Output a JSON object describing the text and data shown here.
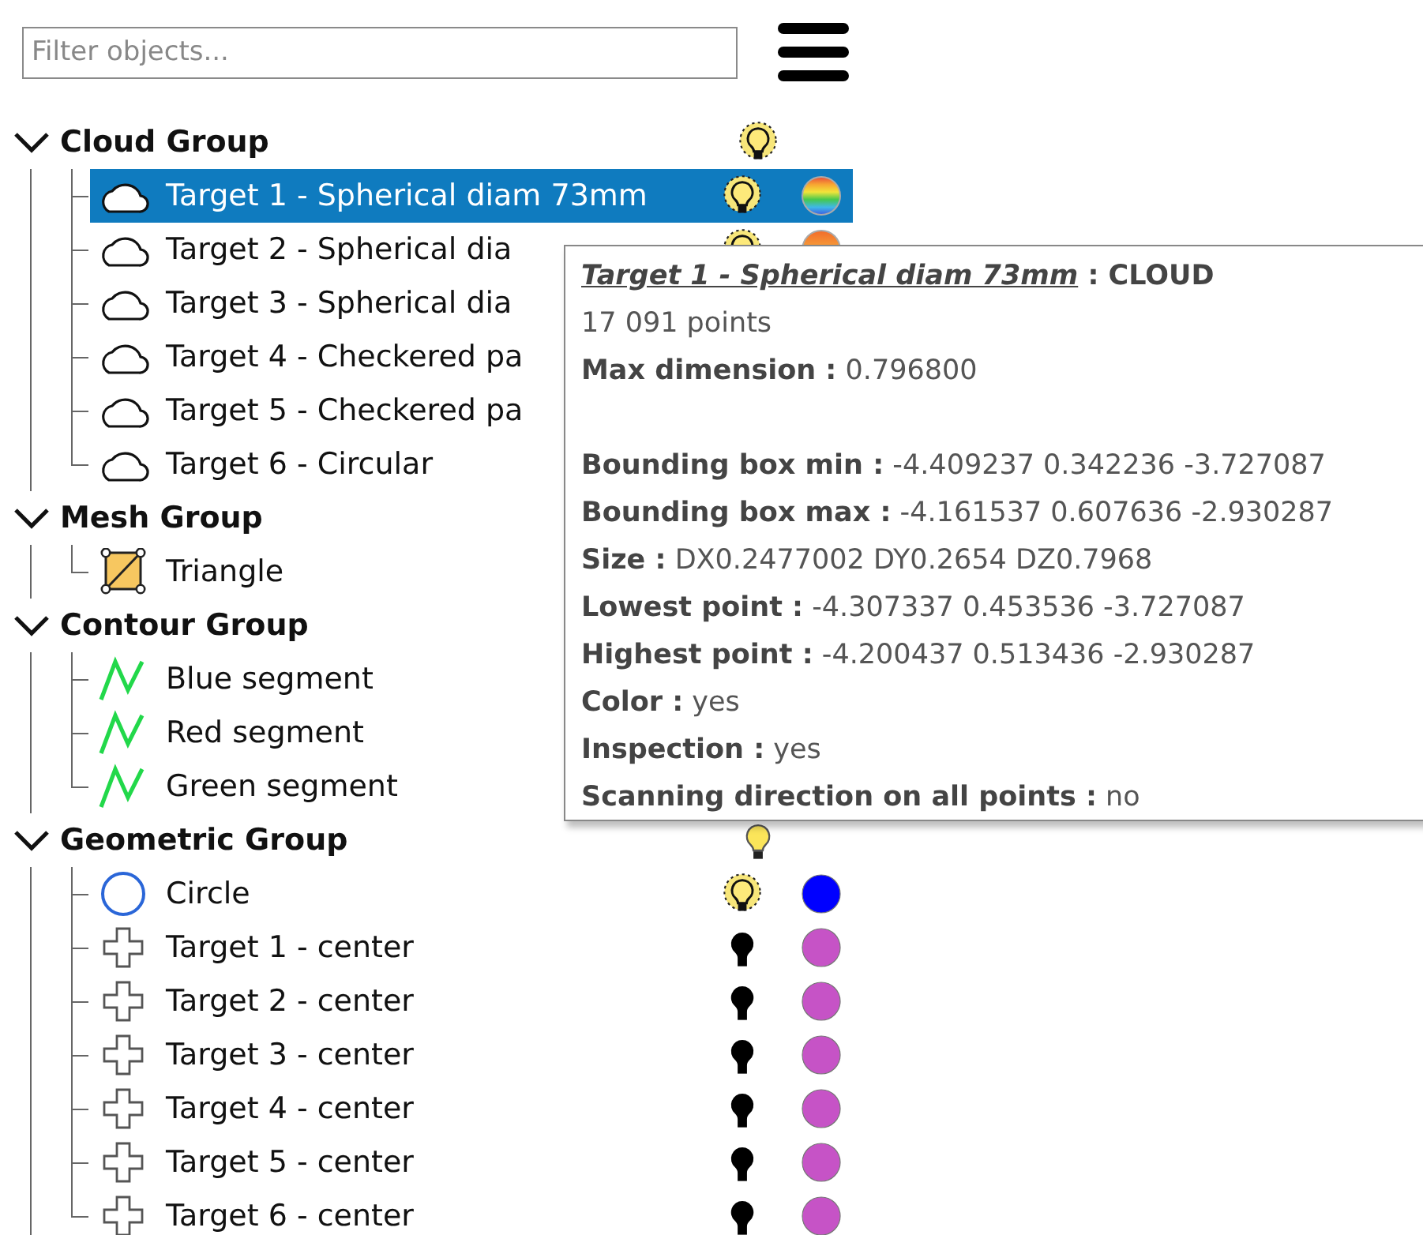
{
  "filter": {
    "placeholder": "Filter objects..."
  },
  "groups": [
    {
      "name": "Cloud Group",
      "expanded": true,
      "light": {
        "lit": true,
        "glow": true
      },
      "items": [
        {
          "kind": "cloud",
          "label": "Target 1 - Spherical diam 73mm",
          "selected": true,
          "light": {
            "lit": true,
            "glow": true
          },
          "dot": {
            "kind": "rainbow"
          }
        },
        {
          "kind": "cloud",
          "label": "Target 2 - Spherical dia",
          "selected": false,
          "light": {
            "lit": true,
            "glow": true
          },
          "dot": {
            "kind": "warm"
          }
        },
        {
          "kind": "cloud",
          "label": "Target 3 - Spherical dia",
          "selected": false
        },
        {
          "kind": "cloud",
          "label": "Target 4 - Checkered pa",
          "selected": false
        },
        {
          "kind": "cloud",
          "label": "Target 5 - Checkered pa",
          "selected": false
        },
        {
          "kind": "cloud",
          "label": "Target 6 - Circular",
          "selected": false
        }
      ]
    },
    {
      "name": "Mesh Group",
      "expanded": true,
      "items": [
        {
          "kind": "mesh",
          "label": "Triangle",
          "selected": false
        }
      ]
    },
    {
      "name": "Contour Group",
      "expanded": true,
      "items": [
        {
          "kind": "polyline",
          "label": "Blue segment",
          "selected": false
        },
        {
          "kind": "polyline",
          "label": "Red segment",
          "selected": false
        },
        {
          "kind": "polyline",
          "label": "Green segment",
          "selected": false
        }
      ]
    },
    {
      "name": "Geometric Group",
      "expanded": true,
      "light": {
        "lit": true,
        "glow": false
      },
      "items": [
        {
          "kind": "circle",
          "label": "Circle",
          "selected": false,
          "light": {
            "lit": true,
            "glow": true
          },
          "dot": {
            "kind": "solid",
            "color": "#0000ff"
          }
        },
        {
          "kind": "point",
          "label": "Target 1 - center",
          "selected": false,
          "light": {
            "lit": false,
            "glow": false
          },
          "dot": {
            "kind": "solid",
            "color": "#c653c6"
          }
        },
        {
          "kind": "point",
          "label": "Target 2 - center",
          "selected": false,
          "light": {
            "lit": false,
            "glow": false
          },
          "dot": {
            "kind": "solid",
            "color": "#c653c6"
          }
        },
        {
          "kind": "point",
          "label": "Target 3 - center",
          "selected": false,
          "light": {
            "lit": false,
            "glow": false
          },
          "dot": {
            "kind": "solid",
            "color": "#c653c6"
          }
        },
        {
          "kind": "point",
          "label": "Target 4 - center",
          "selected": false,
          "light": {
            "lit": false,
            "glow": false
          },
          "dot": {
            "kind": "solid",
            "color": "#c653c6"
          }
        },
        {
          "kind": "point",
          "label": "Target 5 - center",
          "selected": false,
          "light": {
            "lit": false,
            "glow": false
          },
          "dot": {
            "kind": "solid",
            "color": "#c653c6"
          }
        },
        {
          "kind": "point",
          "label": "Target 6 - center",
          "selected": false,
          "light": {
            "lit": false,
            "glow": false
          },
          "dot": {
            "kind": "solid",
            "color": "#c653c6"
          }
        }
      ]
    }
  ],
  "tooltip": {
    "name": "Target 1 - Spherical diam 73mm",
    "type": " : CLOUD",
    "sections": [
      [
        "17 091 points",
        "**Max dimension :** 0.796800"
      ],
      [
        "**Bounding box min :** -4.409237 0.342236 -3.727087",
        "**Bounding box max :** -4.161537 0.607636 -2.930287",
        "**Size :** DX0.2477002 DY0.2654 DZ0.7968",
        "**Lowest point :** -4.307337 0.453536 -3.727087",
        "**Highest point :** -4.200437 0.513436 -2.930287",
        "**Color :** yes",
        "**Inspection :** yes",
        "**Scanning direction on all points :** no"
      ]
    ]
  }
}
